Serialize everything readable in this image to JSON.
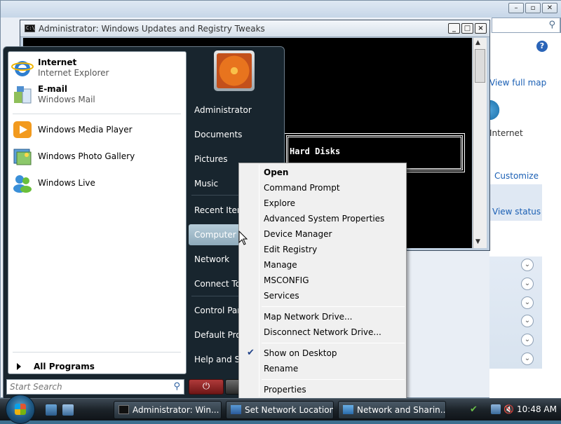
{
  "background_window": {
    "links": {
      "view_full_map": "View full map",
      "customize": "Customize",
      "view_status": "View status"
    },
    "globe_label": "Internet",
    "help_icon": "?"
  },
  "console": {
    "title": "Administrator:  Windows Updates and Registry Tweaks",
    "box_text": "Hard Disks",
    "buttons": {
      "minimize": "_",
      "maximize": "□",
      "close": "×"
    }
  },
  "start_menu": {
    "pinned": [
      {
        "title": "Internet",
        "subtitle": "Internet Explorer",
        "icon": "internet-explorer-icon"
      },
      {
        "title": "E-mail",
        "subtitle": "Windows Mail",
        "icon": "windows-mail-icon"
      }
    ],
    "recent": [
      {
        "title": "Windows Media Player",
        "icon": "media-player-icon"
      },
      {
        "title": "Windows Photo Gallery",
        "icon": "photo-gallery-icon"
      },
      {
        "title": "Windows Live",
        "icon": "windows-live-icon"
      }
    ],
    "all_programs": "All Programs",
    "search_placeholder": "Start Search",
    "right_items": [
      "Administrator",
      "Documents",
      "Pictures",
      "Music",
      "Recent Items",
      "Computer",
      "Network",
      "Connect To",
      "Control Panel",
      "Default Programs",
      "Help and Support"
    ],
    "active_item": "Computer"
  },
  "context_menu": {
    "items": [
      {
        "label": "Open",
        "bold": true
      },
      {
        "label": "Command Prompt"
      },
      {
        "label": "Explore"
      },
      {
        "label": "Advanced System Properties"
      },
      {
        "label": "Device Manager"
      },
      {
        "label": "Edit Registry"
      },
      {
        "label": "Manage"
      },
      {
        "label": "MSCONFIG"
      },
      {
        "label": "Services"
      },
      {
        "label": "Map Network Drive..."
      },
      {
        "label": "Disconnect Network Drive..."
      },
      {
        "label": "Show on Desktop",
        "checked": true
      },
      {
        "label": "Rename"
      },
      {
        "label": "Properties"
      }
    ]
  },
  "taskbar": {
    "buttons": [
      "Administrator:  Win...",
      "Set Network Location",
      "Network and Sharin..."
    ],
    "clock": "10:48 AM"
  }
}
